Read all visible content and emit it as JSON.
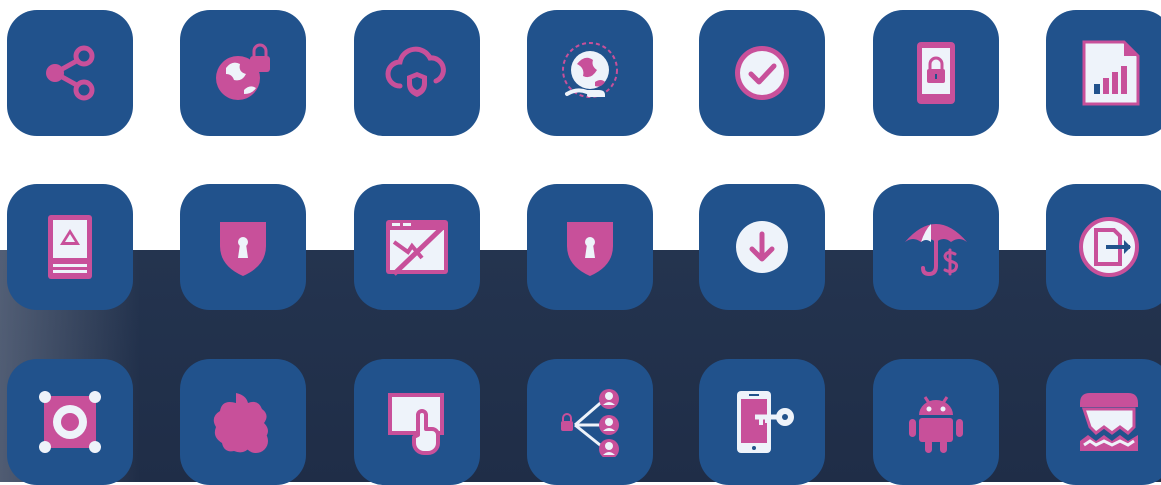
{
  "colors": {
    "background": "#ffffff",
    "band": "#24344f",
    "tile": "#21528c",
    "accent_pink": "#c8509a",
    "light": "#eef3fa"
  },
  "icons": [
    [
      "share-icon",
      "globe-lock-icon",
      "cloud-shield-icon",
      "globe-hand-icon",
      "check-circle-icon",
      "phone-lock-icon",
      "document-chart-icon"
    ],
    [
      "tablet-warning-icon",
      "shield-keyhole-icon",
      "browser-slash-icon",
      "shield-keyhole-icon",
      "download-circle-icon",
      "umbrella-dollar-icon",
      "exit-document-icon"
    ],
    [
      "gear-frame-icon",
      "virus-icon",
      "touch-screen-icon",
      "lock-network-icon",
      "mobile-key-icon",
      "android-icon",
      "shredder-icon"
    ]
  ]
}
